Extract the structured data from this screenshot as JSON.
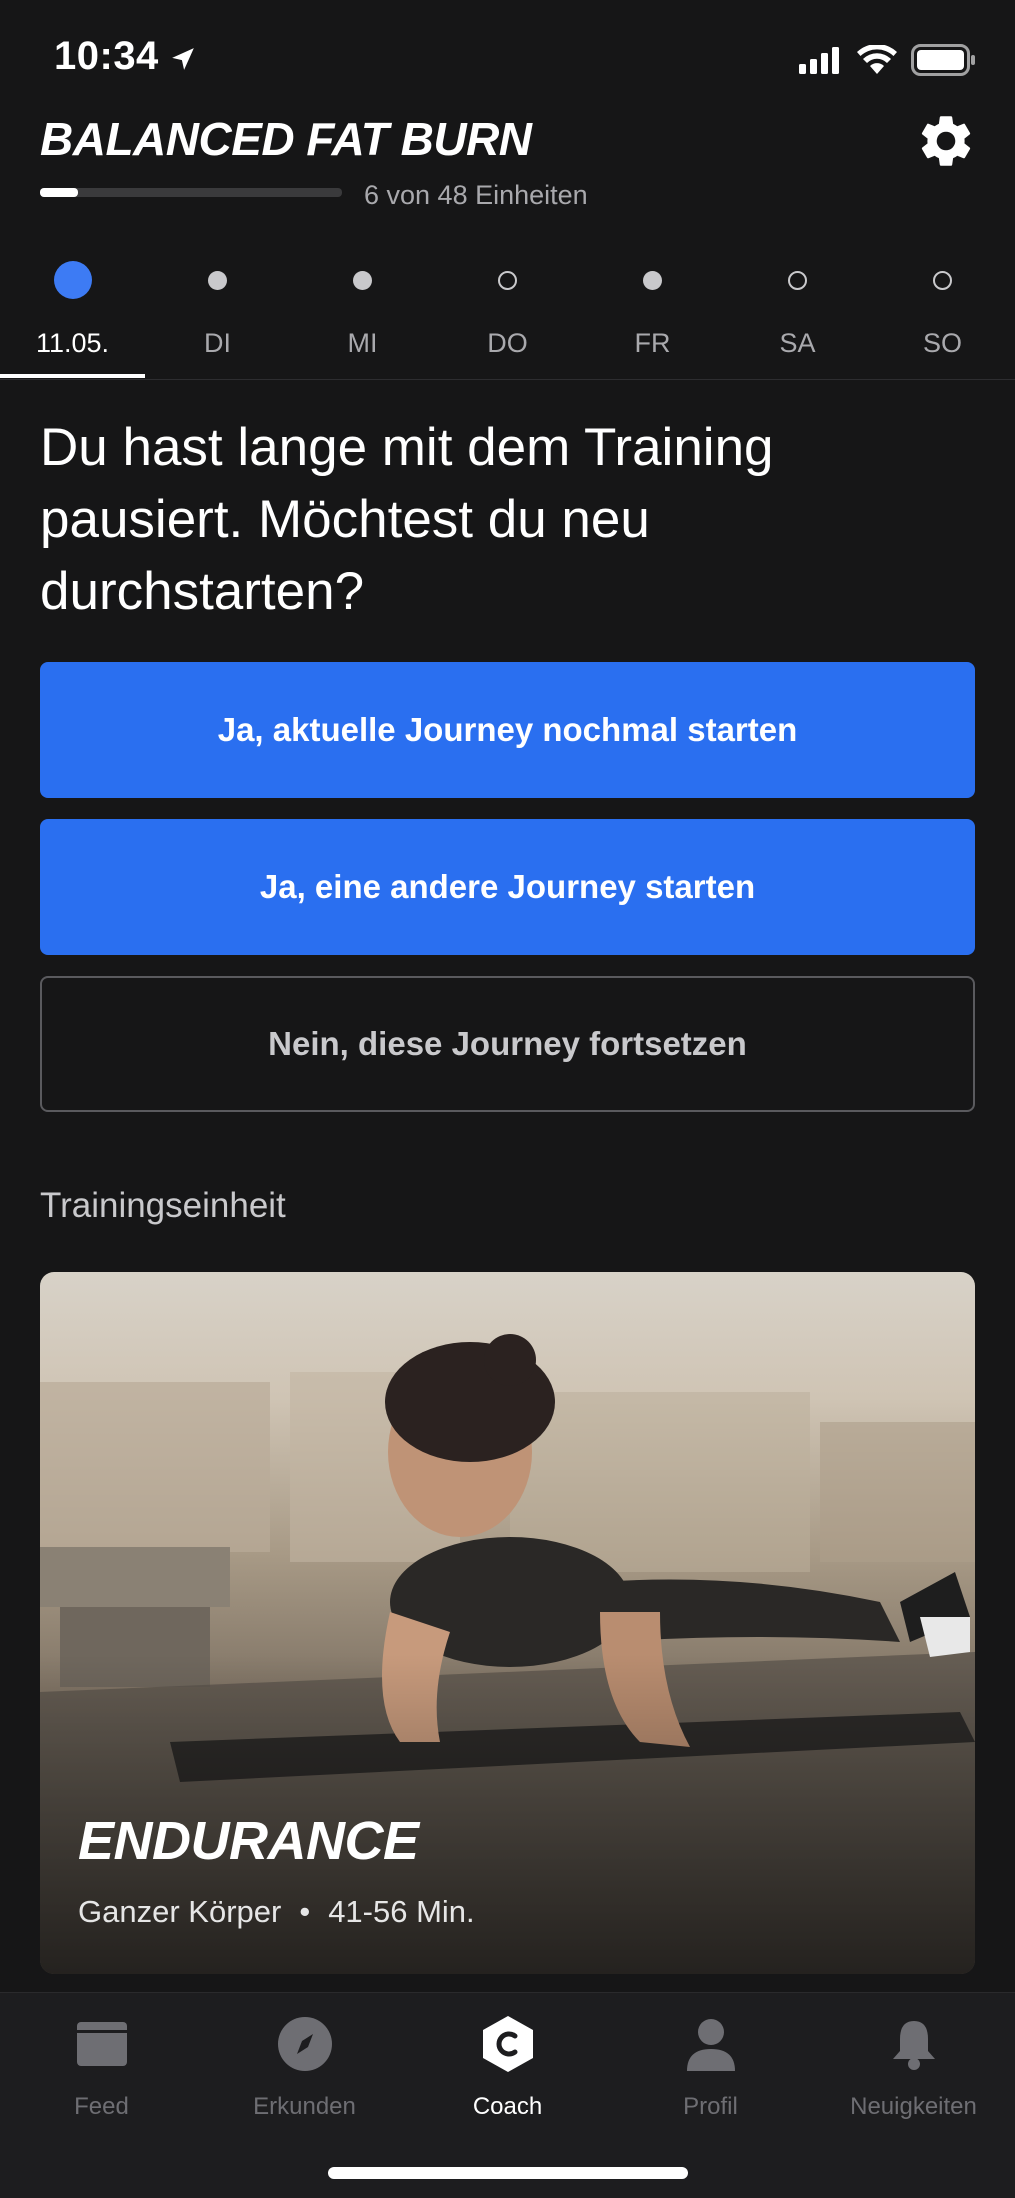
{
  "status_bar": {
    "time": "10:34"
  },
  "header": {
    "title": "BALANCED FAT BURN",
    "progress_text": "6 von 48 Einheiten",
    "progress_fraction": 0.125
  },
  "days": [
    {
      "label": "11.05.",
      "state": "active"
    },
    {
      "label": "DI",
      "state": "filled"
    },
    {
      "label": "MI",
      "state": "filled"
    },
    {
      "label": "DO",
      "state": "empty"
    },
    {
      "label": "FR",
      "state": "filled"
    },
    {
      "label": "SA",
      "state": "empty"
    },
    {
      "label": "SO",
      "state": "empty"
    }
  ],
  "prompt": {
    "question": "Du hast lange mit dem Training pausiert. Möchtest du neu durchstarten?",
    "restart_button": "Ja, aktuelle Journey nochmal starten",
    "other_button": "Ja, eine andere Journey starten",
    "continue_button": "Nein, diese Journey fortsetzen"
  },
  "workout": {
    "section_label": "Trainingseinheit",
    "title": "ENDURANCE",
    "focus": "Ganzer Körper",
    "separator": "•",
    "duration": "41-56 Min."
  },
  "tabs": [
    {
      "label": "Feed",
      "icon": "feed-icon"
    },
    {
      "label": "Erkunden",
      "icon": "compass-icon"
    },
    {
      "label": "Coach",
      "icon": "coach-icon"
    },
    {
      "label": "Profil",
      "icon": "profile-icon"
    },
    {
      "label": "Neuigkeiten",
      "icon": "bell-icon"
    }
  ],
  "colors": {
    "accent": "#2a6ff0",
    "active_dot": "#3d7bf4",
    "background": "#161617"
  }
}
